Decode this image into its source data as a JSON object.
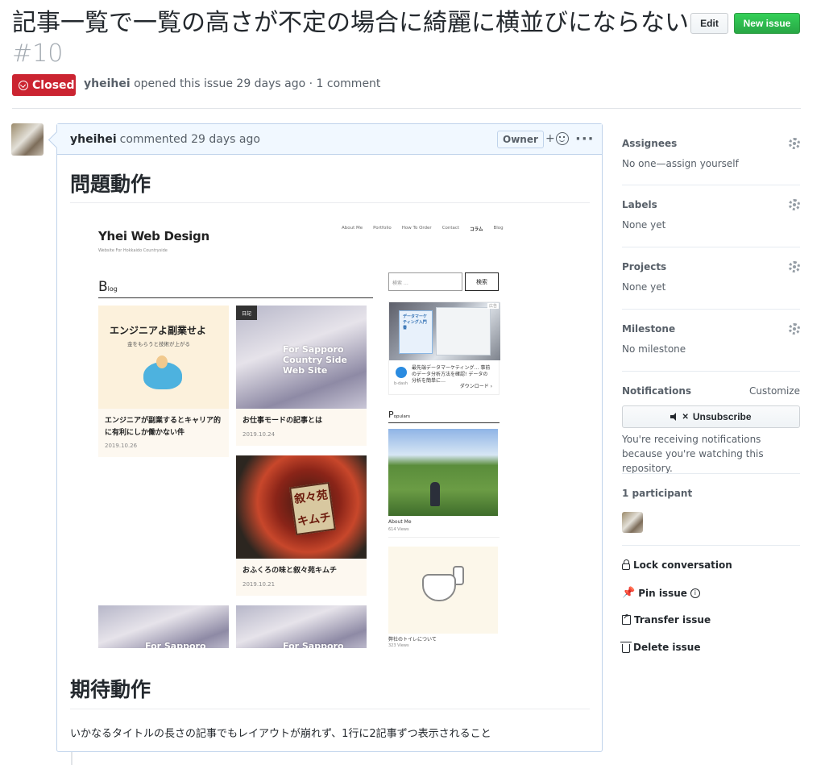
{
  "issue": {
    "title": "記事一覧で一覧の高さが不定の場合に綺麗に横並びにならない",
    "number": "#10",
    "state": "Closed",
    "author": "yheihei",
    "meta_text": "opened this issue 29 days ago · 1 comment"
  },
  "header": {
    "edit_label": "Edit",
    "new_issue_label": "New issue"
  },
  "comment": {
    "author": "yheihei",
    "meta_text": "commented 29 days ago",
    "owner_label": "Owner",
    "reaction_label": "+",
    "more_label": "···",
    "heading_problem": "問題動作",
    "heading_expected": "期待動作",
    "expected_text": "いかなるタイトルの長さの記事でもレイアウトが崩れず、1行に2記事ずつ表示されること"
  },
  "screenshot": {
    "site_title": "Yhei Web Design",
    "site_tagline": "Website For Hokkaido Countryside",
    "nav": [
      "About Me",
      "Portfolio",
      "How To Order",
      "Contact",
      "コラム",
      "Blog"
    ],
    "blog_head_big": "B",
    "blog_head_small": "log",
    "cards": [
      {
        "img_text": "エンジニアよ副業せよ",
        "img_sub": "金をもらうと技術が上がる",
        "title": "エンジニアが副業するとキャリア的に有利にしか働かない件",
        "date": "2019.10.26"
      },
      {
        "tag": "日記",
        "img_text": "For Sapporo Country Side Web Site",
        "title": "お仕事モードの記事とは",
        "date": "2019.10.24"
      },
      {
        "img_text": "叙々苑 キムチ",
        "title": "おふくろの味と叙々苑キムチ",
        "date": "2019.10.21"
      },
      {
        "img_text": "For Sapporo"
      },
      {
        "img_text": "For Sapporo"
      }
    ],
    "search_placeholder": "検索 …",
    "search_button": "検索",
    "ad": {
      "tag": "広告",
      "book_text": "データマーケティング入門書",
      "text": "最先端データマーケティング… 事前のデータ分析方法を確認! データの分析を簡単に… ",
      "brand": "b-dash",
      "download": "ダウンロード ›"
    },
    "popular_head_big": "P",
    "popular_head_small": "opulars",
    "popular": [
      {
        "caption": "About Me",
        "views": "614 Views"
      },
      {
        "caption": "弊社のトイレについて",
        "views": "323 Views"
      }
    ]
  },
  "sidebar": {
    "assignees": {
      "heading": "Assignees",
      "value": "No one—assign yourself"
    },
    "labels": {
      "heading": "Labels",
      "value": "None yet"
    },
    "projects": {
      "heading": "Projects",
      "value": "None yet"
    },
    "milestone": {
      "heading": "Milestone",
      "value": "No milestone"
    },
    "notifications": {
      "heading": "Notifications",
      "customize": "Customize",
      "unsubscribe": "Unsubscribe",
      "reason": "You're receiving notifications because you're watching this repository."
    },
    "participants": {
      "heading": "1 participant"
    },
    "actions": {
      "lock": "Lock conversation",
      "pin": "Pin issue",
      "transfer": "Transfer issue",
      "delete": "Delete issue"
    }
  }
}
